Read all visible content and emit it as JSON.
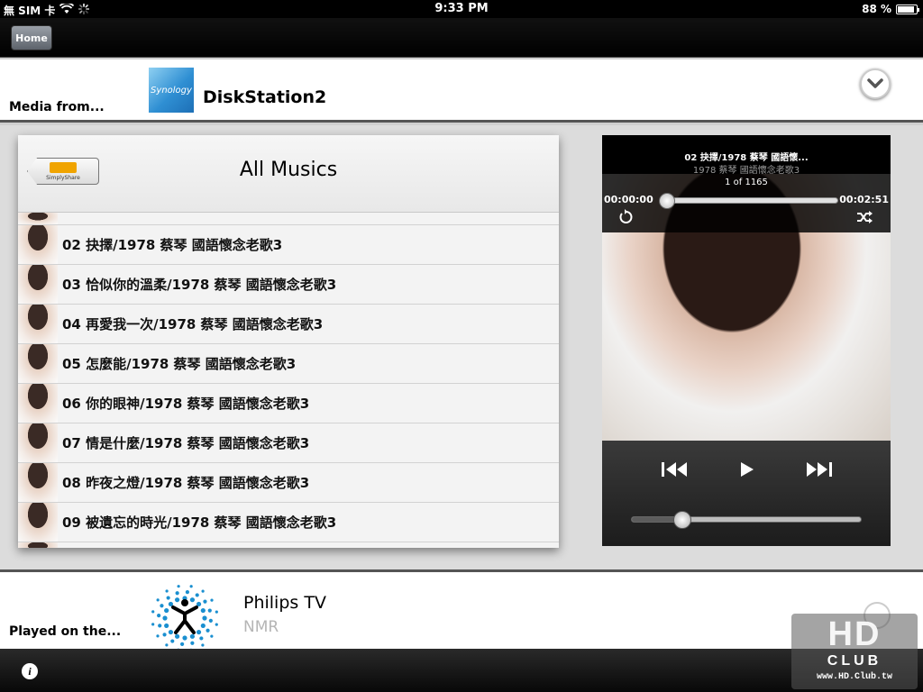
{
  "status_bar": {
    "carrier": "無 SIM 卡",
    "time": "9:33 PM",
    "battery_text": "88 %",
    "battery_level": 0.88
  },
  "nav": {
    "home_label": "Home"
  },
  "media_from": {
    "label": "Media from...",
    "logo_text": "Synology",
    "server_name": "DiskStation2"
  },
  "list": {
    "back_logo_text": "SimplyShare",
    "title": "All Musics",
    "tracks": [
      {
        "title": "02 抉擇/1978 蔡琴 國語懷念老歌3"
      },
      {
        "title": "03 恰似你的溫柔/1978 蔡琴 國語懷念老歌3"
      },
      {
        "title": "04 再愛我一次/1978 蔡琴 國語懷念老歌3"
      },
      {
        "title": "05 怎麼能/1978 蔡琴 國語懷念老歌3"
      },
      {
        "title": "06 你的眼神/1978 蔡琴 國語懷念老歌3"
      },
      {
        "title": "07 情是什麼/1978 蔡琴 國語懷念老歌3"
      },
      {
        "title": "08 昨夜之燈/1978 蔡琴 國語懷念老歌3"
      },
      {
        "title": "09 被遺忘的時光/1978 蔡琴 國語懷念老歌3"
      }
    ]
  },
  "player": {
    "title": "02 抉擇/1978 蔡琴 國語懷...",
    "subtitle": "1978 蔡琴 國語懷念老歌3",
    "count": "1 of 1165",
    "elapsed": "00:00:00",
    "duration": "00:02:51",
    "progress": 0.0,
    "volume": 0.22
  },
  "played_on": {
    "label": "Played on the...",
    "device_name": "Philips TV",
    "device_type": "NMR"
  },
  "watermark": {
    "big": "HD",
    "club": "CLUB",
    "url": "www.HD.Club.tw"
  },
  "colors": {
    "philips_blue": "#1a8fd0",
    "synology_blue": "#2f8fd3",
    "simplyshare_orange": "#f0a400"
  }
}
